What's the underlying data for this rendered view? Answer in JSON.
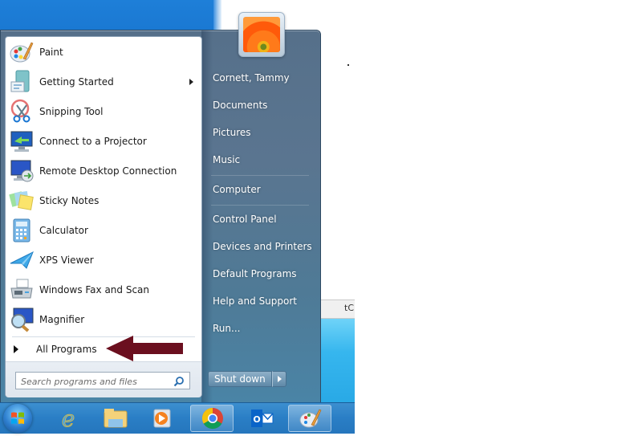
{
  "start_menu": {
    "pinned_programs": [
      {
        "label": "Paint",
        "icon": "paint-icon",
        "has_submenu": false
      },
      {
        "label": "Getting Started",
        "icon": "getting-started-icon",
        "has_submenu": true
      },
      {
        "label": "Snipping Tool",
        "icon": "snipping-tool-icon",
        "has_submenu": false
      },
      {
        "label": "Connect to a Projector",
        "icon": "projector-icon",
        "has_submenu": false
      },
      {
        "label": "Remote Desktop Connection",
        "icon": "remote-desktop-icon",
        "has_submenu": false
      },
      {
        "label": "Sticky Notes",
        "icon": "sticky-notes-icon",
        "has_submenu": false
      },
      {
        "label": "Calculator",
        "icon": "calculator-icon",
        "has_submenu": false
      },
      {
        "label": "XPS Viewer",
        "icon": "xps-viewer-icon",
        "has_submenu": false
      },
      {
        "label": "Windows Fax and Scan",
        "icon": "fax-scan-icon",
        "has_submenu": false
      },
      {
        "label": "Magnifier",
        "icon": "magnifier-icon",
        "has_submenu": false
      }
    ],
    "all_programs_label": "All Programs",
    "search": {
      "placeholder": "Search programs and files",
      "value": ""
    },
    "user_name": "Cornett, Tammy",
    "right_items": [
      {
        "label": "Documents"
      },
      {
        "label": "Pictures"
      },
      {
        "label": "Music"
      },
      {
        "label": "Computer"
      },
      {
        "label": "Control Panel"
      },
      {
        "label": "Devices and Printers"
      },
      {
        "label": "Default Programs"
      },
      {
        "label": "Help and Support"
      },
      {
        "label": "Run..."
      }
    ],
    "shutdown_label": "Shut down"
  },
  "annotation": {
    "arrow_color": "#6b0f1f",
    "points_to": "All Programs"
  },
  "taskbar": {
    "items": [
      {
        "name": "start-button",
        "icon": "windows-orb-icon"
      },
      {
        "name": "internet-explorer",
        "icon": "internet-explorer-icon",
        "active": false
      },
      {
        "name": "windows-explorer",
        "icon": "file-explorer-icon",
        "active": false
      },
      {
        "name": "media-player",
        "icon": "media-player-icon",
        "active": false
      },
      {
        "name": "chrome",
        "icon": "chrome-icon",
        "active": true
      },
      {
        "name": "outlook",
        "icon": "outlook-icon",
        "active": false
      },
      {
        "name": "paint",
        "icon": "paint-icon",
        "active": true
      }
    ]
  },
  "background_window": {
    "partial_text": "tC"
  }
}
